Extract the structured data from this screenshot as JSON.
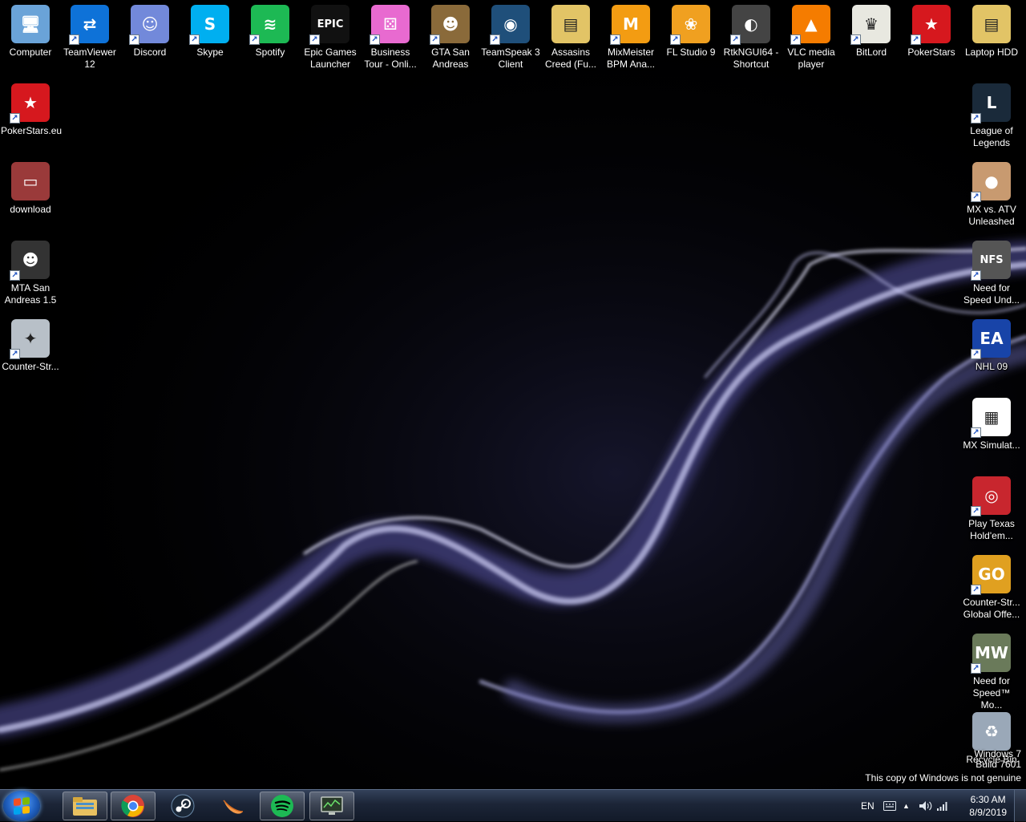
{
  "desktop": {
    "icons": [
      {
        "id": "computer",
        "label": "Computer",
        "icon": "computer-icon",
        "color": "#6aa3d8",
        "glyph": "🖥"
      },
      {
        "id": "teamviewer",
        "label": "TeamViewer 12",
        "icon": "teamviewer-icon",
        "color": "#0e72d8",
        "glyph": "⇄"
      },
      {
        "id": "discord",
        "label": "Discord",
        "icon": "discord-icon",
        "color": "#7289da",
        "glyph": "☺"
      },
      {
        "id": "skype",
        "label": "Skype",
        "icon": "skype-icon",
        "color": "#00aff0",
        "glyph": "S"
      },
      {
        "id": "spotify",
        "label": "Spotify",
        "icon": "spotify-icon",
        "color": "#1db954",
        "glyph": "≋"
      },
      {
        "id": "epic",
        "label": "Epic Games Launcher",
        "icon": "epic-games-icon",
        "color": "#111111",
        "glyph": "EPIC"
      },
      {
        "id": "business-tour",
        "label": "Business Tour - Onli...",
        "icon": "business-tour-icon",
        "color": "#e86ad0",
        "glyph": "⚄"
      },
      {
        "id": "gta-sa",
        "label": "GTA San Andreas",
        "icon": "gta-icon",
        "color": "#8a6a3a",
        "glyph": "☻"
      },
      {
        "id": "teamspeak",
        "label": "TeamSpeak 3 Client",
        "icon": "teamspeak-icon",
        "color": "#1f4f7a",
        "glyph": "◉"
      },
      {
        "id": "assassins",
        "label": "Assasins Creed (Fu...",
        "icon": "folder-icon",
        "color": "#e2c466",
        "glyph": "▤"
      },
      {
        "id": "mixmeister",
        "label": "MixMeister BPM Ana...",
        "icon": "mixmeister-icon",
        "color": "#f39c12",
        "glyph": "M"
      },
      {
        "id": "flstudio",
        "label": "FL Studio 9",
        "icon": "fl-studio-icon",
        "color": "#f0a020",
        "glyph": "❀"
      },
      {
        "id": "rtk",
        "label": "RtkNGUI64 - Shortcut",
        "icon": "speaker-icon",
        "color": "#444444",
        "glyph": "◐"
      },
      {
        "id": "vlc",
        "label": "VLC media player",
        "icon": "vlc-icon",
        "color": "#f57c00",
        "glyph": "▲"
      },
      {
        "id": "bitlord",
        "label": "BitLord",
        "icon": "bitlord-icon",
        "color": "#e8e8e0",
        "glyph": "♛"
      },
      {
        "id": "pokerstars-top",
        "label": "PokerStars",
        "icon": "pokerstars-icon",
        "color": "#d6181e",
        "glyph": "★"
      },
      {
        "id": "laptop-hdd",
        "label": "Laptop HDD",
        "icon": "folder-icon",
        "color": "#e2c466",
        "glyph": "▤"
      },
      {
        "id": "pokerstars-eu",
        "label": "PokerStars.eu",
        "icon": "pokerstars-icon",
        "color": "#d6181e",
        "glyph": "★"
      },
      {
        "id": "download",
        "label": "download",
        "icon": "image-file-icon",
        "color": "#9a3a3a",
        "glyph": "▭"
      },
      {
        "id": "mta",
        "label": "MTA San Andreas 1.5",
        "icon": "mta-icon",
        "color": "#333333",
        "glyph": "☻"
      },
      {
        "id": "cs",
        "label": "Counter-Str...",
        "icon": "counter-strike-icon",
        "color": "#b8c0c8",
        "glyph": "✦"
      },
      {
        "id": "lol",
        "label": "League of Legends",
        "icon": "league-of-legends-icon",
        "color": "#1a2a3a",
        "glyph": "L"
      },
      {
        "id": "mx-atv",
        "label": "MX vs. ATV Unleashed",
        "icon": "mx-atv-icon",
        "color": "#c89a70",
        "glyph": "●"
      },
      {
        "id": "nfs-u",
        "label": "Need for Speed Und...",
        "icon": "nfs-underground-icon",
        "color": "#555555",
        "glyph": "NFS"
      },
      {
        "id": "nhl09",
        "label": "NHL 09",
        "icon": "nhl09-icon",
        "color": "#1844a8",
        "glyph": "EA"
      },
      {
        "id": "mx-sim",
        "label": "MX Simulat...",
        "icon": "checkered-flag-icon",
        "color": "#ffffff",
        "glyph": "▦"
      },
      {
        "id": "texas",
        "label": "Play Texas Hold'em...",
        "icon": "poker-chips-icon",
        "color": "#c8262e",
        "glyph": "◎"
      },
      {
        "id": "csgo",
        "label": "Counter-Str... Global Offe...",
        "icon": "csgo-icon",
        "color": "#e0a020",
        "glyph": "GO"
      },
      {
        "id": "nfs-mw",
        "label": "Need for Speed™ Mo...",
        "icon": "nfs-most-wanted-icon",
        "color": "#6a7a5a",
        "glyph": "MW"
      },
      {
        "id": "recycle",
        "label": "Recycle Bin",
        "icon": "recycle-bin-icon",
        "color": "#9aa8b8",
        "glyph": "♻"
      }
    ]
  },
  "watermark": {
    "line1": "Windows 7",
    "line2": "Build 7601",
    "line3": "This copy of Windows is not genuine"
  },
  "taskbar": {
    "start_icon": "windows-start-icon",
    "pinned": [
      {
        "id": "explorer",
        "icon": "windows-explorer-icon",
        "color": "#e8c060"
      },
      {
        "id": "chrome",
        "icon": "chrome-icon",
        "color": "#db4437"
      },
      {
        "id": "steam",
        "icon": "steam-icon",
        "color": "#1b2838"
      },
      {
        "id": "peach",
        "icon": "fruit-app-icon",
        "color": "#f49a4a"
      },
      {
        "id": "spotify",
        "icon": "spotify-icon",
        "color": "#1db954"
      },
      {
        "id": "monitor",
        "icon": "monitor-app-icon",
        "color": "#5a9a5a"
      }
    ],
    "tray": {
      "language": "EN",
      "time": "6:30 AM",
      "date": "8/9/2019"
    }
  }
}
